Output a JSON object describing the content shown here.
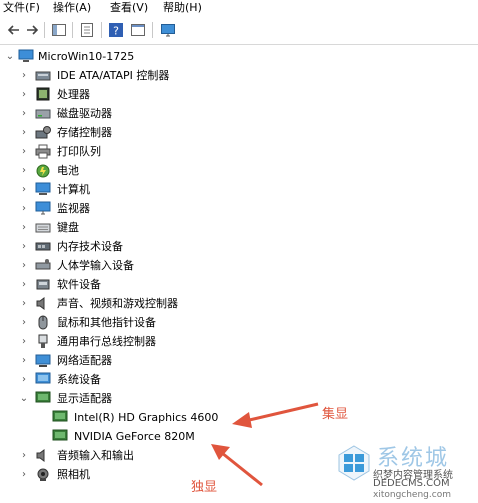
{
  "menu": [
    "文件(F)",
    "操作(A)",
    "查看(V)",
    "帮助(H)"
  ],
  "toolbar_icons": [
    "back-arrow-icon",
    "forward-arrow-icon",
    "console-tree-icon",
    "properties-icon",
    "help-icon",
    "window-icon",
    "monitor-icon"
  ],
  "tree": {
    "root": "MicroWin10-1725",
    "categories": [
      {
        "label": "IDE ATA/ATAPI 控制器",
        "icon": "ide-controller-icon"
      },
      {
        "label": "处理器",
        "icon": "processor-icon"
      },
      {
        "label": "磁盘驱动器",
        "icon": "disk-drive-icon"
      },
      {
        "label": "存储控制器",
        "icon": "storage-controller-icon"
      },
      {
        "label": "打印队列",
        "icon": "printer-icon"
      },
      {
        "label": "电池",
        "icon": "battery-icon"
      },
      {
        "label": "计算机",
        "icon": "computer-icon"
      },
      {
        "label": "监视器",
        "icon": "monitor-icon"
      },
      {
        "label": "键盘",
        "icon": "keyboard-icon"
      },
      {
        "label": "内存技术设备",
        "icon": "memory-device-icon"
      },
      {
        "label": "人体学输入设备",
        "icon": "hid-icon"
      },
      {
        "label": "软件设备",
        "icon": "software-device-icon"
      },
      {
        "label": "声音、视频和游戏控制器",
        "icon": "sound-icon"
      },
      {
        "label": "鼠标和其他指针设备",
        "icon": "mouse-icon"
      },
      {
        "label": "通用串行总线控制器",
        "icon": "usb-icon"
      },
      {
        "label": "网络适配器",
        "icon": "network-adapter-icon"
      },
      {
        "label": "系统设备",
        "icon": "system-device-icon"
      },
      {
        "label": "显示适配器",
        "icon": "display-adapter-icon",
        "expanded": true,
        "children": [
          "Intel(R) HD Graphics 4600",
          "NVIDIA GeForce 820M"
        ]
      },
      {
        "label": "音频输入和输出",
        "icon": "audio-io-icon"
      },
      {
        "label": "照相机",
        "icon": "camera-icon"
      }
    ]
  },
  "annotations": {
    "integrated": "集显",
    "discrete": "独显"
  },
  "watermark": {
    "brand": "系统城",
    "line1": "织梦内容管理系统",
    "line2": "DEDECMS.COM",
    "line3": "xitongcheng.com"
  },
  "colors": {
    "arrow": "#e0553d",
    "selection": "#cce8ff"
  }
}
